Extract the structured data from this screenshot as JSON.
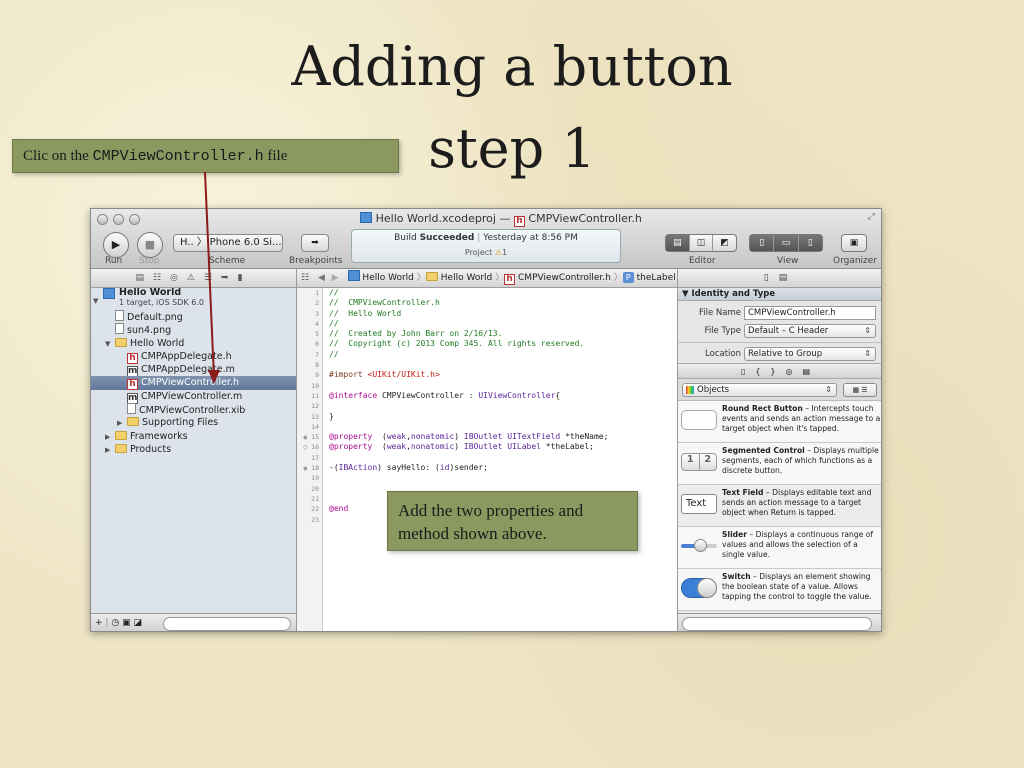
{
  "slide": {
    "title_line1": "Adding a button",
    "title_line2": "step 1",
    "callout_top_prefix": "Clic on the ",
    "callout_top_file": "CMPViewController.h",
    "callout_top_suffix": " file",
    "callout_bottom": "Add the two properties and method shown above."
  },
  "window": {
    "title_project": "Hello World.xcodeproj",
    "title_sep": "—",
    "title_file": "CMPViewController.h"
  },
  "toolbar": {
    "run_label": "Run",
    "stop_label": "Stop",
    "scheme_label": "Scheme",
    "scheme_value": "H.. 〉iPhone 6.0 Si...",
    "breakpoints_label": "Breakpoints",
    "status_prefix": "Build ",
    "status_bold": "Succeeded",
    "status_time": "Yesterday at 8:56 PM",
    "status_project": "Project",
    "status_warnings": "1",
    "editor_label": "Editor",
    "view_label": "View",
    "organizer_label": "Organizer"
  },
  "jumpbar": {
    "items": [
      "Hello World",
      "Hello World",
      "CMPViewController.h",
      "theLabel"
    ]
  },
  "navigator": {
    "project_name": "Hello World",
    "project_sub": "1 target, iOS SDK 6.0",
    "items": [
      {
        "label": "Default.png",
        "type": "file",
        "indent": 1
      },
      {
        "label": "sun4.png",
        "type": "file",
        "indent": 1
      },
      {
        "label": "Hello World",
        "type": "folder",
        "indent": 1,
        "open": true
      },
      {
        "label": "CMPAppDelegate.h",
        "type": "h",
        "indent": 2
      },
      {
        "label": "CMPAppDelegate.m",
        "type": "m",
        "indent": 2
      },
      {
        "label": "CMPViewController.h",
        "type": "h",
        "indent": 2,
        "selected": true
      },
      {
        "label": "CMPViewController.m",
        "type": "m",
        "indent": 2
      },
      {
        "label": "CMPViewController.xib",
        "type": "file",
        "indent": 2
      },
      {
        "label": "Supporting Files",
        "type": "folder",
        "indent": 2
      },
      {
        "label": "Frameworks",
        "type": "folder",
        "indent": 1
      },
      {
        "label": "Products",
        "type": "folder",
        "indent": 1
      }
    ]
  },
  "editor": {
    "line_numbers": [
      "1",
      "2",
      "3",
      "4",
      "5",
      "6",
      "7",
      "8",
      "9",
      "10",
      "11",
      "12",
      "13",
      "14",
      "15",
      "16",
      "17",
      "18",
      "19",
      "20",
      "21",
      "22",
      "23"
    ],
    "lines": [
      "//",
      "//  CMPViewController.h",
      "//  Hello World",
      "//",
      "//  Created by John Barr on 2/16/13.",
      "//  Copyright (c) 2013 Comp 345. All rights reserved.",
      "//",
      "",
      "#import <UIKit/UIKit.h>",
      "",
      "@interface CMPViewController : UIViewController{",
      "",
      "}",
      "",
      "@property  (weak,nonatomic) IBOutlet UITextField *theName;",
      "@property  (weak,nonatomic) IBOutlet UILabel *theLabel;",
      "",
      "-(IBAction) sayHello: (id)sender;",
      "",
      "",
      "",
      "@end",
      ""
    ]
  },
  "inspector": {
    "section_title": "Identity and Type",
    "file_name_label": "File Name",
    "file_name_value": "CMPViewController.h",
    "file_type_label": "File Type",
    "file_type_value": "Default – C Header",
    "location_label": "Location",
    "location_value": "Relative to Group",
    "library_select": "Objects",
    "objects": [
      {
        "name": "Round Rect Button",
        "desc": " – Intercepts touch events and sends an action message to a target object when it's tapped."
      },
      {
        "name": "Segmented Control",
        "desc": " – Displays multiple segments, each of which functions as a discrete button."
      },
      {
        "name": "Text Field",
        "desc": " – Displays editable text and sends an action message to a target object when Return is tapped."
      },
      {
        "name": "Slider",
        "desc": " – Displays a continuous range of values and allows the selection of a single value."
      },
      {
        "name": "Switch",
        "desc": " – Displays an element showing the boolean state of a value. Allows tapping the control to toggle the value."
      }
    ],
    "textfield_thumb": "Text",
    "segmented_thumb": [
      "1",
      "2"
    ]
  },
  "colors": {
    "callout_bg": "#8b9960",
    "arrow": "#8b1a1a",
    "selection": "#6a81a3"
  }
}
